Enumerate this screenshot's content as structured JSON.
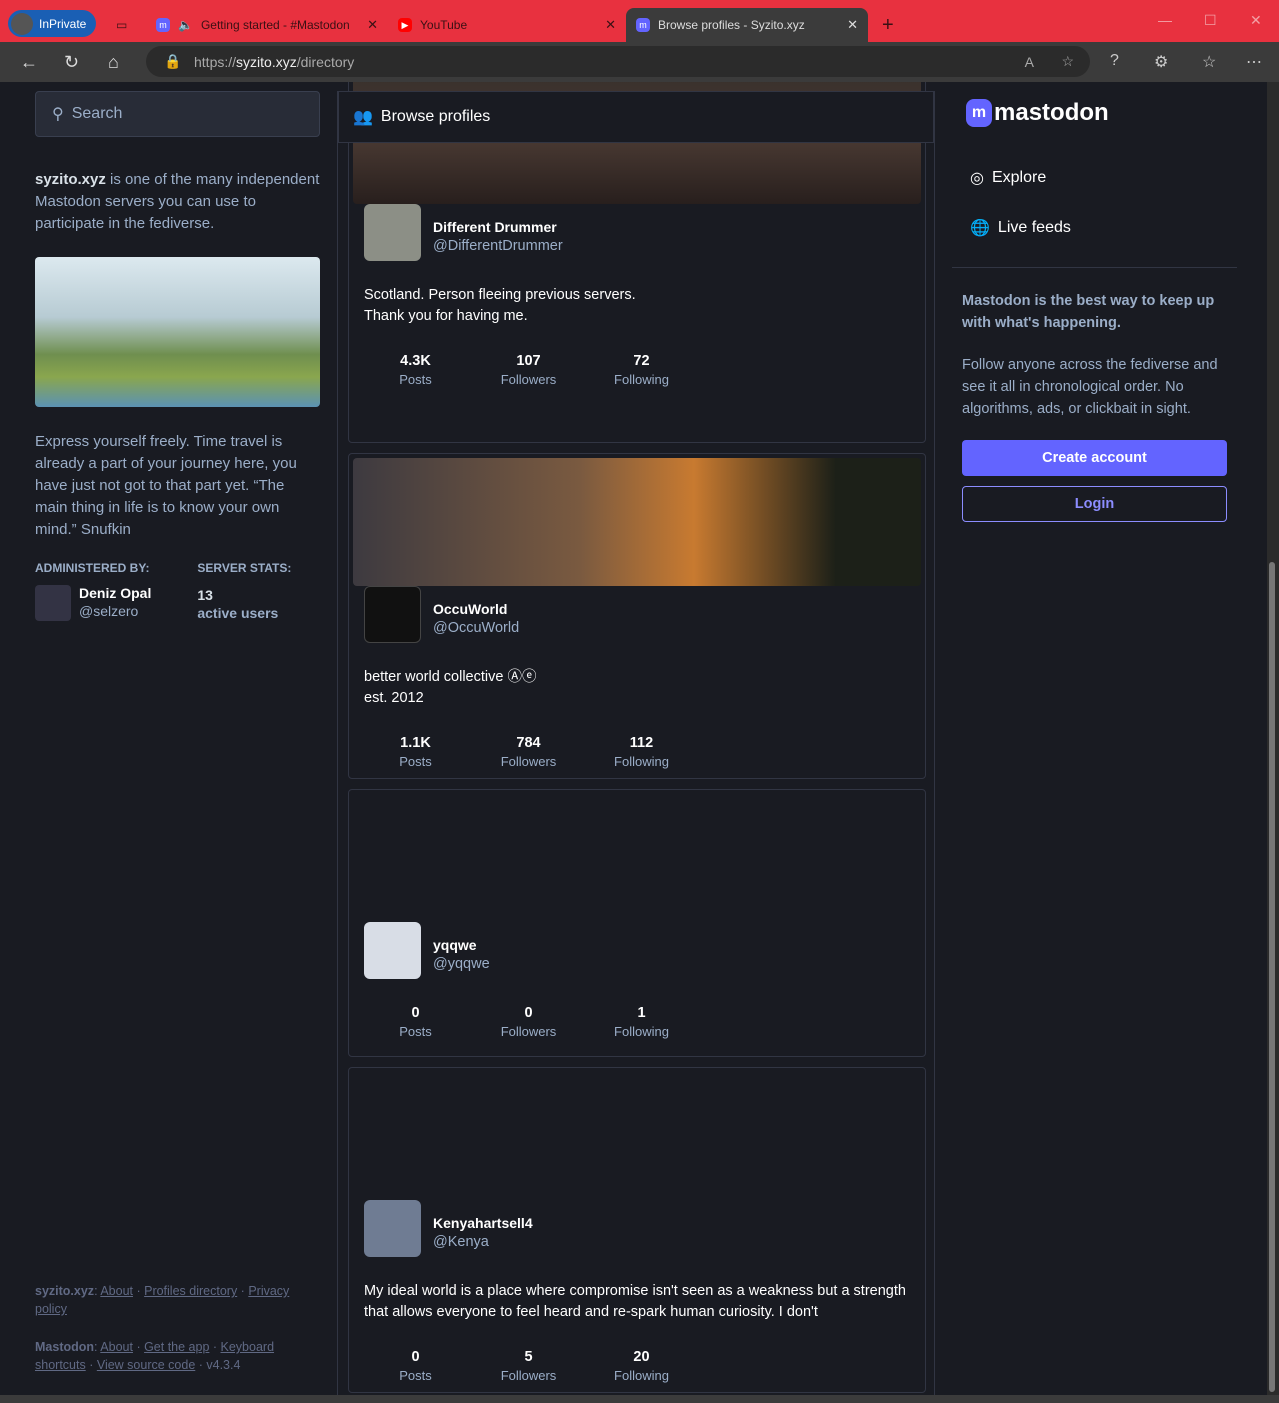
{
  "browser": {
    "inprivate": "InPrivate",
    "tabs": [
      {
        "title": "Getting started - #Mastodon"
      },
      {
        "title": "YouTube"
      },
      {
        "title": "Browse profiles - Syzito.xyz"
      }
    ],
    "url_prefix": "https://",
    "url_host": "syzito.xyz",
    "url_path": "/directory"
  },
  "left": {
    "search_placeholder": "Search",
    "server": "syzito.xyz",
    "about_rest": " is one of the many independent Mastodon servers you can use to participate in the fediverse.",
    "description": "Express yourself freely. Time travel is already a part of your journey here, you have just not got to that part yet. “The main thing in life is to know your own mind.” Snufkin",
    "admin_label": "ADMINISTERED BY:",
    "stats_label": "SERVER STATS:",
    "admin_name": "Deniz Opal",
    "admin_handle": "@selzero",
    "active_users": "13",
    "active_label": "active users"
  },
  "footer": {
    "server_label": "syzito.xyz",
    "about": "About",
    "profiles": "Profiles directory",
    "privacy": "Privacy policy",
    "mastodon_label": "Mastodon",
    "m_about": "About",
    "get_app": "Get the app",
    "shortcuts": "Keyboard shortcuts",
    "source": "View source code",
    "version": "v4.3.4"
  },
  "main": {
    "title": "Browse profiles",
    "profiles": [
      {
        "name": "Different Drummer",
        "handle": "@DifferentDrummer",
        "bio": "Scotland. Person fleeing previous servers.\nThank you for having me.",
        "posts": "4.3K",
        "followers": "107",
        "following": "72"
      },
      {
        "name": "OccuWorld",
        "handle": "@OccuWorld",
        "bio": "better world collective Ⓐⓔ\nest. 2012",
        "posts": "1.1K",
        "followers": "784",
        "following": "112"
      },
      {
        "name": "yqqwe",
        "handle": "@yqqwe",
        "bio": "",
        "posts": "0",
        "followers": "0",
        "following": "1"
      },
      {
        "name": "Kenyahartsell4",
        "handle": "@Kenya",
        "bio": "My ideal world is a place where compromise isn't seen as a weakness but a strength that allows everyone to feel heard and re-spark human curiosity. I don't",
        "posts": "0",
        "followers": "5",
        "following": "20"
      }
    ],
    "labels": {
      "posts": "Posts",
      "followers": "Followers",
      "following": "Following"
    }
  },
  "right": {
    "logo": "mastodon",
    "explore": "Explore",
    "live": "Live feeds",
    "lead": "Mastodon is the best way to keep up with what's happening.",
    "desc": "Follow anyone across the fediverse and see it all in chronological order. No algorithms, ads, or clickbait in sight.",
    "create": "Create account",
    "login": "Login"
  }
}
